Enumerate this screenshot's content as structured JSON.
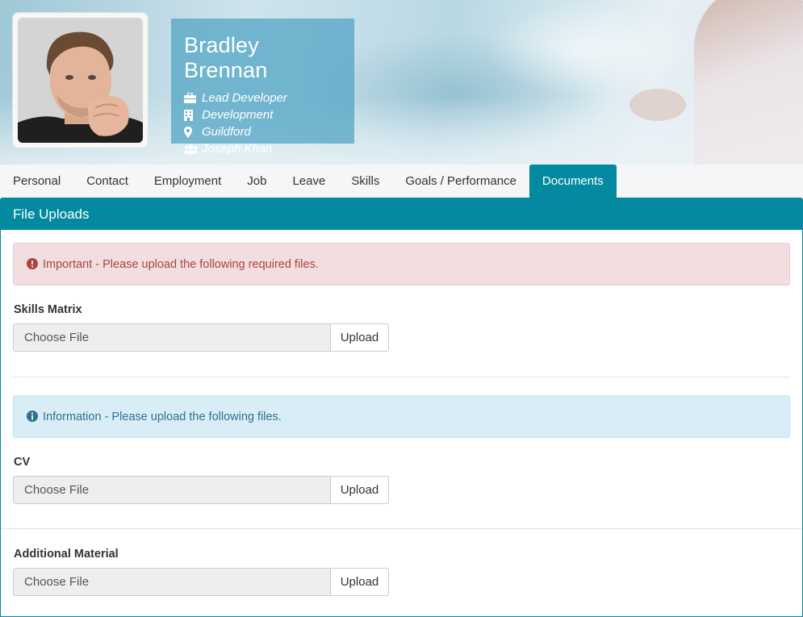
{
  "profile": {
    "name": "Bradley Brennan",
    "title": "Lead Developer",
    "department": "Development",
    "location": "Guildford",
    "manager": "Joseph Khan",
    "icons": [
      "briefcase-icon",
      "building-icon",
      "map-marker-icon",
      "users-icon"
    ]
  },
  "tabs": [
    {
      "label": "Personal"
    },
    {
      "label": "Contact"
    },
    {
      "label": "Employment"
    },
    {
      "label": "Job"
    },
    {
      "label": "Leave"
    },
    {
      "label": "Skills"
    },
    {
      "label": "Goals / Performance"
    },
    {
      "label": "Documents",
      "active": true
    }
  ],
  "panel": {
    "title": "File Uploads",
    "required_alert": "Important - Please upload the following required files.",
    "info_alert": "Information - Please upload the following files.",
    "fields": [
      {
        "label": "Skills Matrix",
        "placeholder": "Choose File",
        "button": "Upload"
      },
      {
        "label": "CV",
        "placeholder": "Choose File",
        "button": "Upload"
      },
      {
        "label": "Additional Material",
        "placeholder": "Choose File",
        "button": "Upload"
      }
    ]
  },
  "colors": {
    "accent": "#048aa0",
    "danger_bg": "#f2dede",
    "danger_text": "#a94442",
    "info_bg": "#d9edf7",
    "info_text": "#31708f"
  }
}
